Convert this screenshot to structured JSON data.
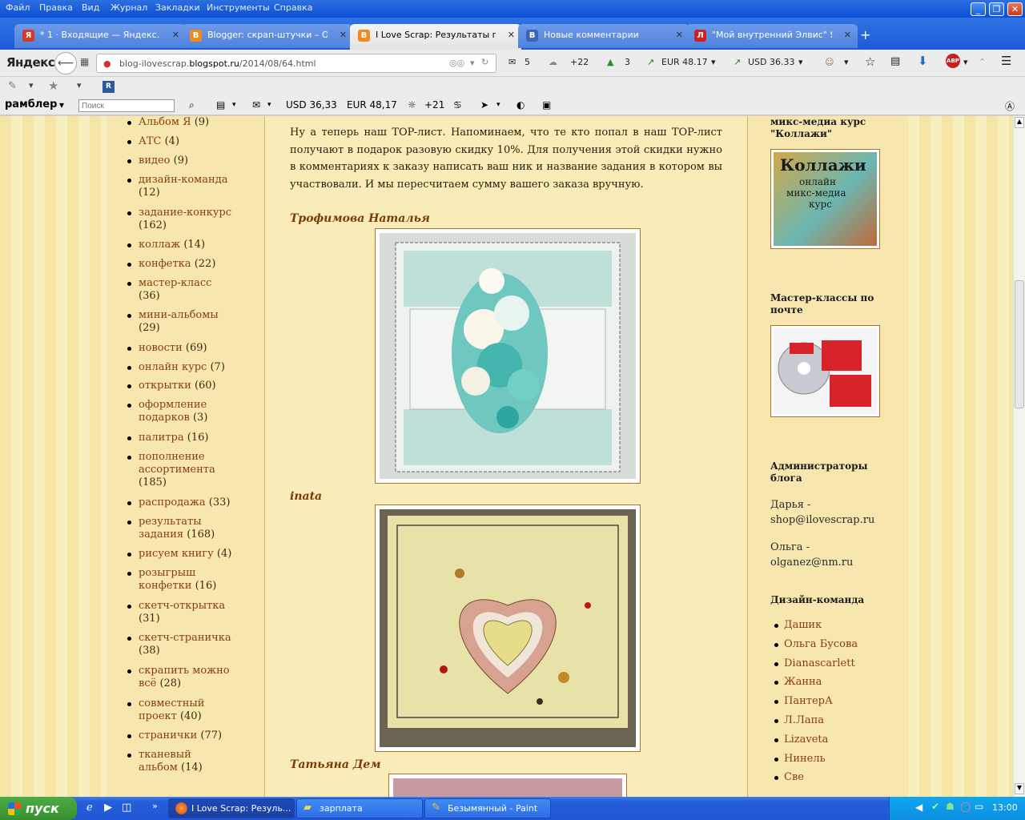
{
  "menu": [
    "Файл",
    "Правка",
    "Вид",
    "Журнал",
    "Закладки",
    "Инструменты",
    "Справка"
  ],
  "tabs": [
    {
      "label": "* 1 · Входящие — Яндекс.П...",
      "icon": "Я",
      "color": "#d23a2a"
    },
    {
      "label": "Blogger: скрап-штучки – Оп...",
      "icon": "B",
      "color": "#f08a1c"
    },
    {
      "label": "I Love Scrap: Результаты по...",
      "icon": "B",
      "color": "#f08a1c"
    },
    {
      "label": "Новые комментарии",
      "icon": "B",
      "color": "#3b64b8"
    },
    {
      "label": "\"Мой внутренний Элвис\" Ян...",
      "icon": "Л",
      "color": "#d22020"
    }
  ],
  "nav": {
    "logo": "Яндекс",
    "url_pre": "blog-ilovescrap.",
    "url_host": "blogspot.ru",
    "url_post": "/2014/08/64.html",
    "mail": "5",
    "weather": "+22",
    "traffic": "3",
    "eur": "EUR 48.17",
    "usd": "USD 36.33"
  },
  "rambler": {
    "logo": "рамблер",
    "search_placeholder": "Поиск",
    "usd": "USD 36,33",
    "eur": "EUR 48,17",
    "temp": "+21"
  },
  "labels": [
    {
      "name": "Альбом Я",
      "count": "(9)"
    },
    {
      "name": "АТС",
      "count": "(4)"
    },
    {
      "name": "видео",
      "count": "(9)"
    },
    {
      "name": "дизайн-команда",
      "count": "(12)"
    },
    {
      "name": "задание-конкурс",
      "count": "(162)"
    },
    {
      "name": "коллаж",
      "count": "(14)"
    },
    {
      "name": "конфетка",
      "count": "(22)"
    },
    {
      "name": "мастер-класс",
      "count": "(36)"
    },
    {
      "name": "мини-альбомы",
      "count": "(29)"
    },
    {
      "name": "новости",
      "count": "(69)"
    },
    {
      "name": "онлайн курс",
      "count": "(7)"
    },
    {
      "name": "открытки",
      "count": "(60)"
    },
    {
      "name": "оформление подарков",
      "count": "(3)"
    },
    {
      "name": "палитра",
      "count": "(16)"
    },
    {
      "name": "пополнение ассортимента",
      "count": "(185)"
    },
    {
      "name": "распродажа",
      "count": "(33)"
    },
    {
      "name": "результаты задания",
      "count": "(168)"
    },
    {
      "name": "рисуем книгу",
      "count": "(4)"
    },
    {
      "name": "розыгрыш конфетки",
      "count": "(16)"
    },
    {
      "name": "скетч-открытка",
      "count": "(31)"
    },
    {
      "name": "скетч-страничка",
      "count": "(38)"
    },
    {
      "name": "скрапить можно всё",
      "count": "(28)"
    },
    {
      "name": "совместный проект",
      "count": "(40)"
    },
    {
      "name": "странички",
      "count": "(77)"
    },
    {
      "name": "тканевый альбом",
      "count": "(14)"
    }
  ],
  "post": {
    "intro": "Ну а теперь наш TOP-лист. Напоминаем, что те кто попал в наш TOP-лист получают в подарок разовую скидку 10%. Для получения этой скидки нужно в комментариях к заказу написать ваш ник и название задания в котором вы участвовали. И мы пересчитаем сумму вашего заказа вручную.",
    "authors": [
      "Трофимова Наталья",
      "inata",
      "Татьяна Дем"
    ]
  },
  "sidebar": {
    "course_title": "микс-медиа курс \"Коллажи\"",
    "course_img_l1": "Коллажи",
    "course_img_l2": "онлайн",
    "course_img_l3": "микс-медиа",
    "course_img_l4": "курс",
    "mk_title": "Мастер-классы по почте",
    "admins_title": "Администраторы блога",
    "admin1_name": "Дарья -",
    "admin1_mail": "shop@ilovescrap.ru",
    "admin2_name": "Ольга -",
    "admin2_mail": "olganez@nm.ru",
    "team_title": "Дизайн-команда",
    "team": [
      "Дашик",
      "Ольга Бусова",
      "Dianascarlett",
      "Жанна",
      "ПантерА",
      "Л.Лапа",
      "Lizaveta",
      "Нинель",
      "Све"
    ]
  },
  "taskbar": {
    "start": "пуск",
    "tasks": [
      "I Love Scrap: Резуль...",
      "зарплата",
      "Безымянный - Paint"
    ],
    "lang": "RU",
    "time": "13:00"
  }
}
